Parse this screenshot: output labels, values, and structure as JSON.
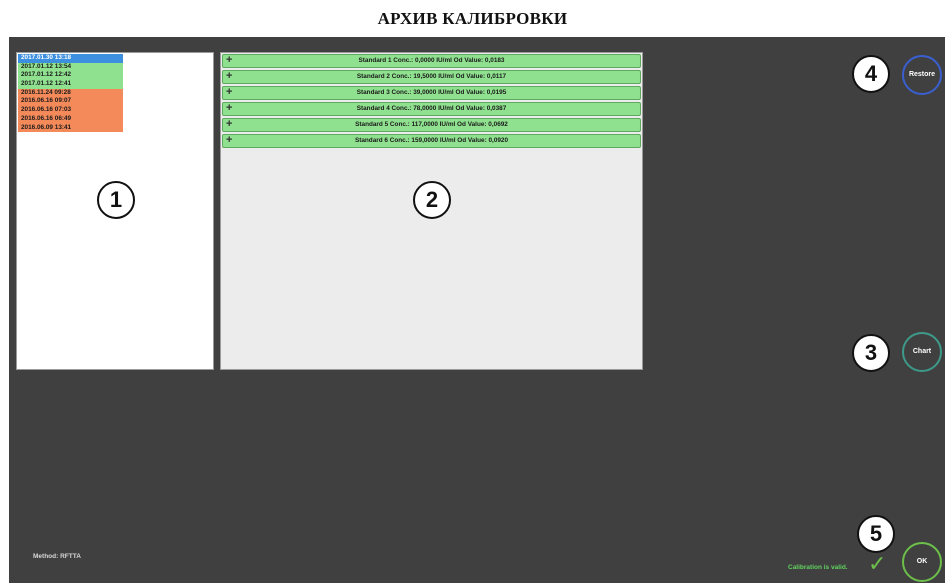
{
  "title": "АРХИВ КАЛИБРОВКИ",
  "history": [
    {
      "label": "2017.01.30 13:18",
      "state": "selected",
      "bg": "#3d8fe0",
      "fg": "#ffffff"
    },
    {
      "label": "2017.01.12 13:54",
      "state": "valid",
      "bg": "#8fe08f",
      "fg": "#1a1a1a"
    },
    {
      "label": "2017.01.12 12:42",
      "state": "valid",
      "bg": "#8fe08f",
      "fg": "#1a1a1a"
    },
    {
      "label": "2017.01.12 12:41",
      "state": "valid",
      "bg": "#8fe08f",
      "fg": "#1a1a1a"
    },
    {
      "label": "2016.11.24 09:28",
      "state": "expired",
      "bg": "#f48a5a",
      "fg": "#1a1a1a"
    },
    {
      "label": "2016.06.16 09:07",
      "state": "expired",
      "bg": "#f48a5a",
      "fg": "#1a1a1a"
    },
    {
      "label": "2016.06.16 07:03",
      "state": "expired",
      "bg": "#f48a5a",
      "fg": "#1a1a1a"
    },
    {
      "label": "2016.06.16 06:49",
      "state": "expired",
      "bg": "#f48a5a",
      "fg": "#1a1a1a"
    },
    {
      "label": "2016.06.09 13:41",
      "state": "expired",
      "bg": "#f48a5a",
      "fg": "#1a1a1a"
    }
  ],
  "standards": [
    {
      "label": "Standard 1  Conc.: 0,0000 IU/ml  Od Value: 0,0183"
    },
    {
      "label": "Standard 2  Conc.: 19,5000 IU/ml  Od Value: 0,0117"
    },
    {
      "label": "Standard 3  Conc.: 39,0000 IU/ml  Od Value: 0,0195"
    },
    {
      "label": "Standard 4  Conc.: 78,0000 IU/ml  Od Value: 0,0387"
    },
    {
      "label": "Standard 5  Conc.: 117,0000 IU/ml  Od Value: 0,0692"
    },
    {
      "label": "Standard 6  Conc.: 159,0000 IU/ml  Od Value: 0,0920"
    }
  ],
  "expand_icon": "plus-icon",
  "markers": {
    "m1": "1",
    "m2": "2",
    "m3": "3",
    "m4": "4",
    "m5": "5"
  },
  "buttons": {
    "restore": {
      "label": "Restore",
      "border": "#3a5fd0"
    },
    "chart": {
      "label": "Chart",
      "border": "#3d9a8a"
    },
    "ok": {
      "label": "OK",
      "border": "#6cc04a"
    }
  },
  "footer": {
    "method": "Method:   RFTTA",
    "status": "Calibration is valid.",
    "status_icon": "check-icon"
  },
  "colors": {
    "background": "#404040",
    "valid": "#8fe08f",
    "expired": "#f48a5a",
    "selected": "#3d8fe0"
  }
}
